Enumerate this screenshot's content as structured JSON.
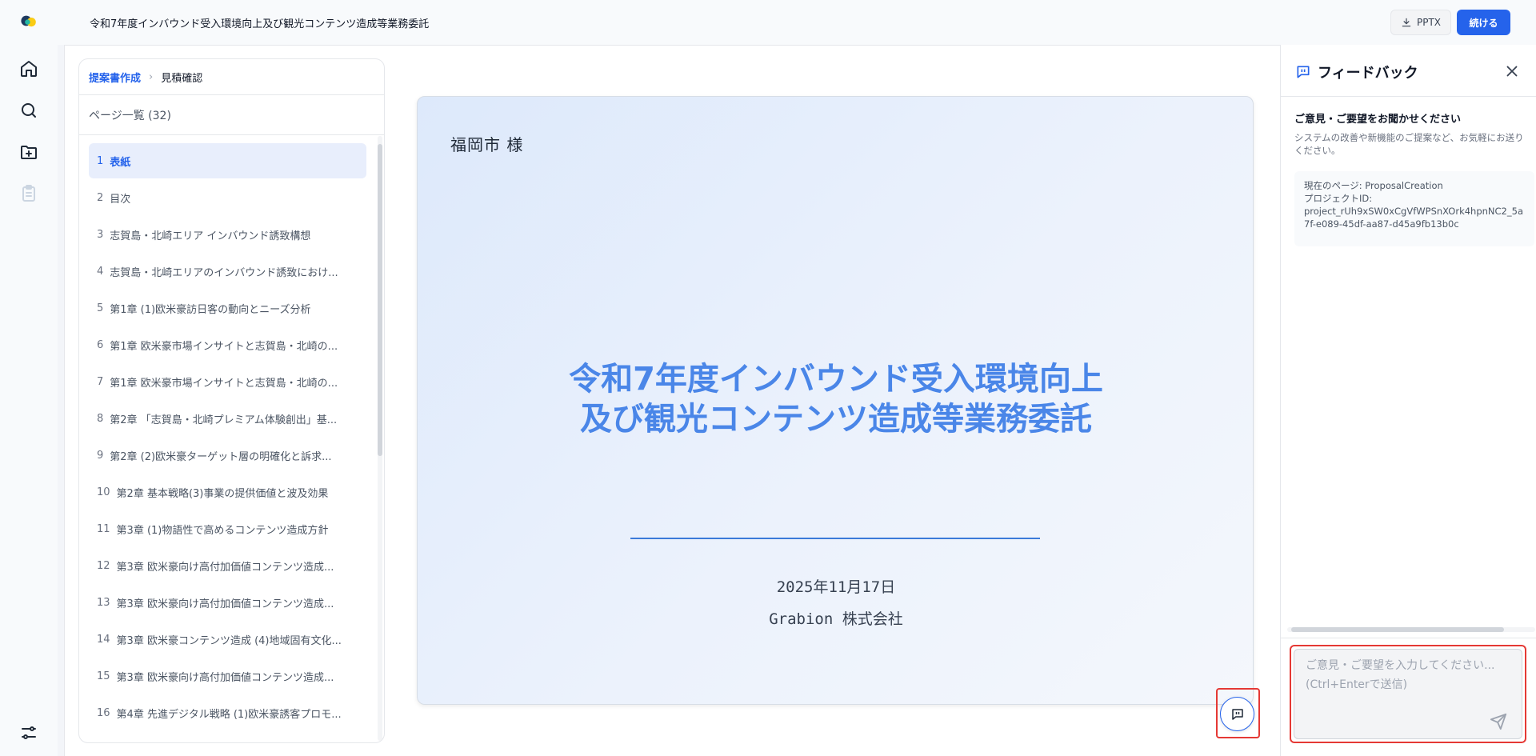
{
  "header": {
    "document_title": "令和7年度インバウンド受入環境向上及び観光コンテンツ造成等業務委託",
    "export_label": "PPTX",
    "continue_label": "続ける"
  },
  "nav_rail": {
    "items": [
      {
        "icon": "home-icon"
      },
      {
        "icon": "search-icon"
      },
      {
        "icon": "folder-plus-icon"
      },
      {
        "icon": "clipboard-icon",
        "disabled": true
      },
      {
        "icon": "sliders-icon"
      }
    ]
  },
  "breadcrumb": {
    "link": "提案書作成",
    "current": "見積確認"
  },
  "page_list": {
    "heading": "ページ一覧 (32)",
    "items": [
      {
        "num": "1",
        "label": "表紙",
        "active": true
      },
      {
        "num": "2",
        "label": "目次"
      },
      {
        "num": "3",
        "label": "志賀島・北崎エリア インバウンド誘致構想"
      },
      {
        "num": "4",
        "label": "志賀島・北崎エリアのインバウンド誘致におけ..."
      },
      {
        "num": "5",
        "label": "第1章 (1)欧米豪訪日客の動向とニーズ分析"
      },
      {
        "num": "6",
        "label": "第1章 欧米豪市場インサイトと志賀島・北崎の..."
      },
      {
        "num": "7",
        "label": "第1章 欧米豪市場インサイトと志賀島・北崎の..."
      },
      {
        "num": "8",
        "label": "第2章 「志賀島・北崎プレミアム体験創出」基..."
      },
      {
        "num": "9",
        "label": "第2章 (2)欧米豪ターゲット層の明確化と訴求..."
      },
      {
        "num": "10",
        "label": "第2章 基本戦略(3)事業の提供価値と波及効果"
      },
      {
        "num": "11",
        "label": "第3章 (1)物語性で高めるコンテンツ造成方針"
      },
      {
        "num": "12",
        "label": "第3章 欧米豪向け高付加価値コンテンツ造成..."
      },
      {
        "num": "13",
        "label": "第3章 欧米豪向け高付加価値コンテンツ造成..."
      },
      {
        "num": "14",
        "label": "第3章 欧米豪コンテンツ造成 (4)地域固有文化..."
      },
      {
        "num": "15",
        "label": "第3章 欧米豪向け高付加価値コンテンツ造成..."
      },
      {
        "num": "16",
        "label": "第4章 先進デジタル戦略 (1)欧米豪誘客プロモ..."
      }
    ]
  },
  "slide": {
    "client": "福岡市 様",
    "title_line1": "令和7年度インバウンド受入環境向上",
    "title_line2": "及び観光コンテンツ造成等業務委託",
    "date": "2025年11月17日",
    "company": "Grabion 株式会社",
    "accent": "#4a86e8"
  },
  "feedback": {
    "title": "フィードバック",
    "subtitle": "ご意見・ご要望をお聞かせください",
    "description": "システムの改善や新機能のご提案など、お気軽にお送りください。",
    "current_page_label": "現在のページ: ProposalCreation",
    "project_id_label": "プロジェクトID:",
    "project_id": "project_rUh9xSW0xCgVfWPSnXOrk4hpnNC2_5a7f-e089-45df-aa87-d45a9fb13b0c",
    "input_placeholder": "ご意見・ご要望を入力してください... (Ctrl+Enterで送信)"
  },
  "colors": {
    "primary": "#2563eb",
    "highlight_border": "#e53935",
    "active_item_bg": "#e8eefc"
  }
}
